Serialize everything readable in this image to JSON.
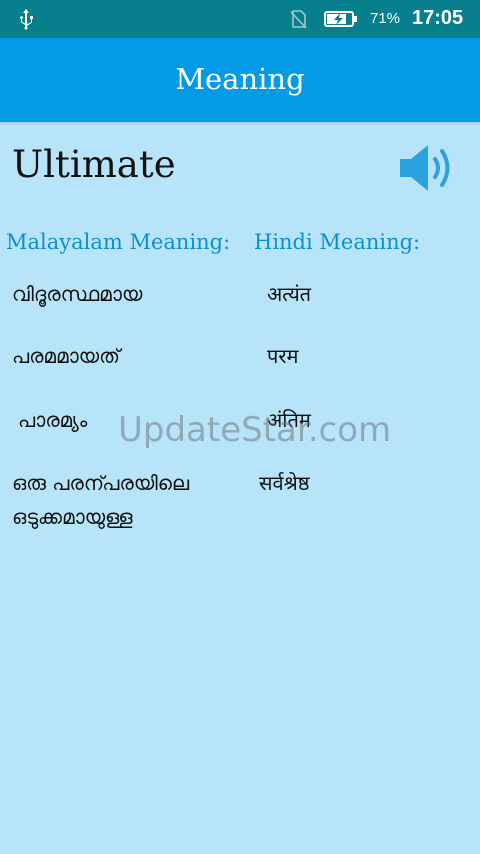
{
  "status_bar": {
    "battery_percent": "71%",
    "time": "17:05"
  },
  "app_bar": {
    "title": "Meaning"
  },
  "word": {
    "text": "Ultimate"
  },
  "headers": {
    "malayalam": "Malayalam Meaning:",
    "hindi": "Hindi Meaning:"
  },
  "meanings": {
    "malayalam": [
      "വിദൂരസ്ഥമായ",
      "പരമമായത്",
      "പാരമ്യം",
      "ഒരു പരന്പരയിലെ",
      "ഒടുക്കമായുള്ള"
    ],
    "hindi": [
      "अत्यंत",
      "परम",
      "अंतिम",
      "सर्वश्रेष्ठ"
    ]
  },
  "watermark": "UpdateStar.com",
  "colors": {
    "status_bar": "#077f8d",
    "app_bar": "#039be5",
    "background": "#b8e4f9",
    "header_text": "#0d8fd0",
    "speaker": "#2aa2df"
  }
}
